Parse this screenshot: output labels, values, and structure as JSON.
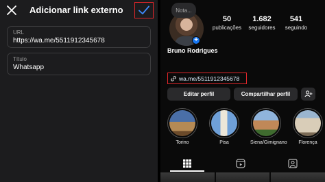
{
  "edit_link": {
    "title": "Adicionar link externo",
    "url_label": "URL",
    "url_value": "https://wa.me/5511912345678",
    "title_label": "Título",
    "title_value": "Whatsapp"
  },
  "profile": {
    "note_placeholder": "Nota...",
    "username": "Bruno Rodrigues",
    "stats": [
      {
        "value": "50",
        "label": "publicações"
      },
      {
        "value": "1.682",
        "label": "seguidores"
      },
      {
        "value": "541",
        "label": "seguindo"
      }
    ],
    "link": "wa.me/5511912345678",
    "edit_button": "Editar perfil",
    "share_button": "Compartilhar perfil",
    "highlights": [
      {
        "label": "Torino"
      },
      {
        "label": "Pisa"
      },
      {
        "label": "Siena/Gimignano"
      },
      {
        "label": "Florença"
      }
    ]
  },
  "colors": {
    "accent_box": "#e0262a",
    "add_badge": "#1877f2"
  }
}
